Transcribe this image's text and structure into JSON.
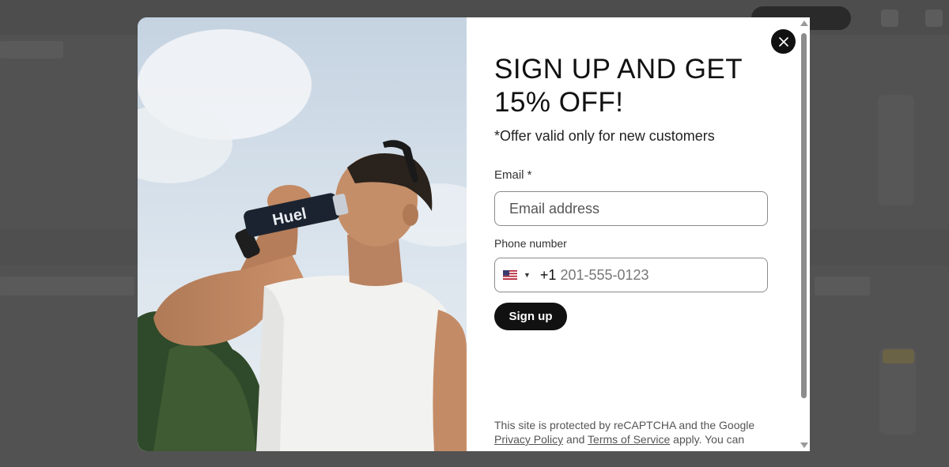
{
  "popup": {
    "title": "SIGN UP AND GET 15% OFF!",
    "subtitle": "*Offer valid only for new customers",
    "email": {
      "label": "Email *",
      "placeholder": "Email address",
      "value": ""
    },
    "phone": {
      "label": "Phone number",
      "country": "US",
      "dial_code": "+1",
      "placeholder": "201-555-0123"
    },
    "submit_label": "Sign up",
    "legal": {
      "intro": "This site is protected by reCAPTCHA and the Google",
      "privacy_link": "Privacy Policy",
      "and": "and",
      "terms_link": "Terms of Service",
      "tail": "apply. You can"
    },
    "image": {
      "bottle_text": "Huel"
    }
  },
  "icons": {
    "close": "close-icon",
    "flag": "us-flag-icon",
    "caret": "caret-down-icon"
  },
  "colors": {
    "primary": "#111111",
    "overlay": "#4d4d4d",
    "field_border": "#8a8a8a"
  }
}
